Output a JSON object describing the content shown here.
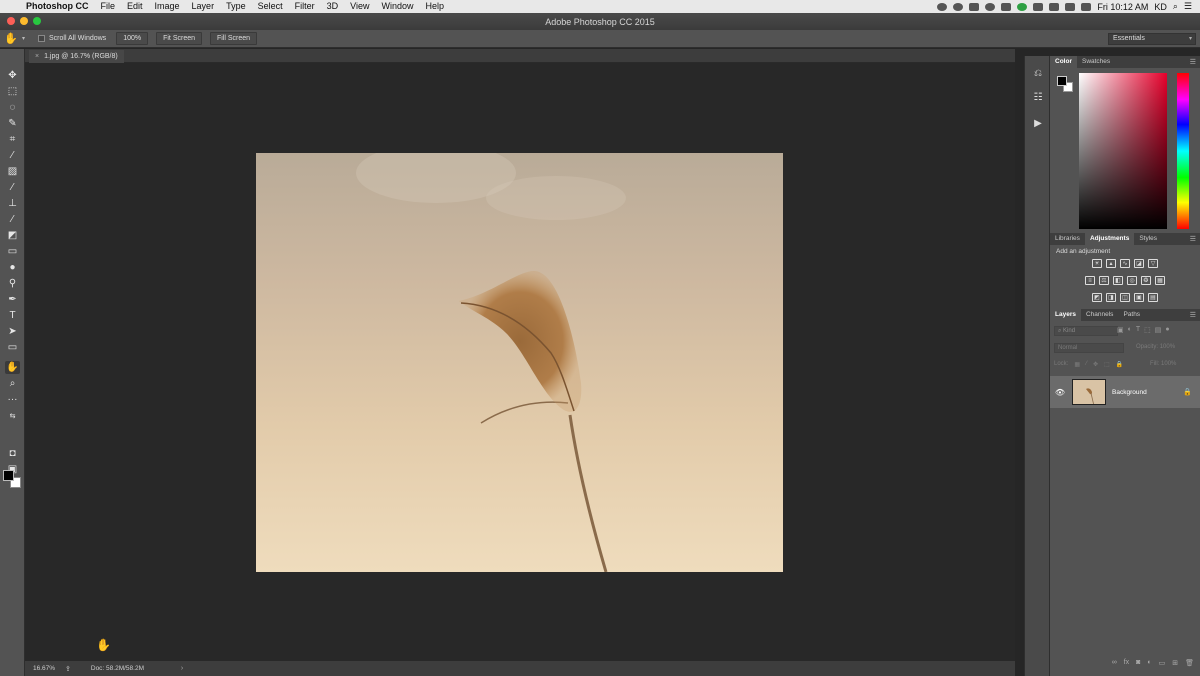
{
  "menubar": {
    "app_name": "Photoshop CC",
    "items": [
      "File",
      "Edit",
      "Image",
      "Layer",
      "Type",
      "Select",
      "Filter",
      "3D",
      "View",
      "Window",
      "Help"
    ],
    "clock": "Fri 10:12 AM",
    "user": "KD"
  },
  "window": {
    "title": "Adobe Photoshop CC 2015"
  },
  "options": {
    "scroll_all_windows": "Scroll All Windows",
    "btn_100": "100%",
    "fit_screen": "Fit Screen",
    "fill_screen": "Fill Screen",
    "workspace": "Essentials"
  },
  "document": {
    "tab_label": "1.jpg @ 16.7% (RGB/8)",
    "zoom": "16.67%",
    "doc_size": "Doc: 58.2M/58.2M"
  },
  "panels": {
    "color_tabs": [
      "Color",
      "Swatches"
    ],
    "adj_tabs": [
      "Libraries",
      "Adjustments",
      "Styles"
    ],
    "adj_title": "Add an adjustment",
    "layers_tabs": [
      "Layers",
      "Channels",
      "Paths"
    ],
    "filter_placeholder": "Kind",
    "blend_mode": "Normal",
    "opacity_label": "Opacity:",
    "opacity_value": "100%",
    "lock_label": "Lock:",
    "fill_label": "Fill:",
    "fill_value": "100%",
    "layer_name": "Background"
  },
  "colors": {
    "foreground": "#000000",
    "background": "#ffffff"
  }
}
